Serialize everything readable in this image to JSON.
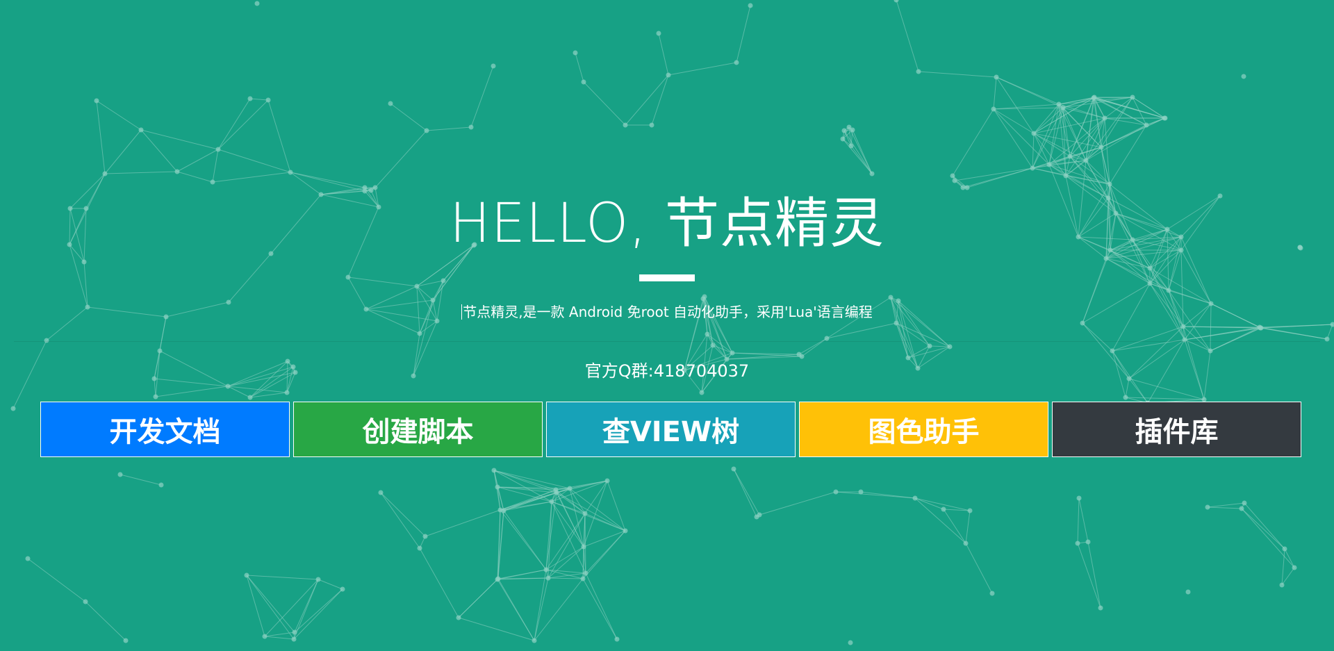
{
  "theme": {
    "background": "#17a185",
    "particle_color": "#8fd1c3"
  },
  "hero": {
    "title": "HELLO, 节点精灵",
    "subtitle": "节点精灵,是一款 Android 免root 自动化助手，采用'Lua'语言编程",
    "qq_group": "官方Q群:418704037"
  },
  "buttons": [
    {
      "label": "开发文档",
      "color": "#007bff"
    },
    {
      "label": "创建脚本",
      "color": "#28a745"
    },
    {
      "label": "查VIEW树",
      "color": "#17a2b8"
    },
    {
      "label": "图色助手",
      "color": "#ffc107"
    },
    {
      "label": "插件库",
      "color": "#343a40"
    }
  ]
}
